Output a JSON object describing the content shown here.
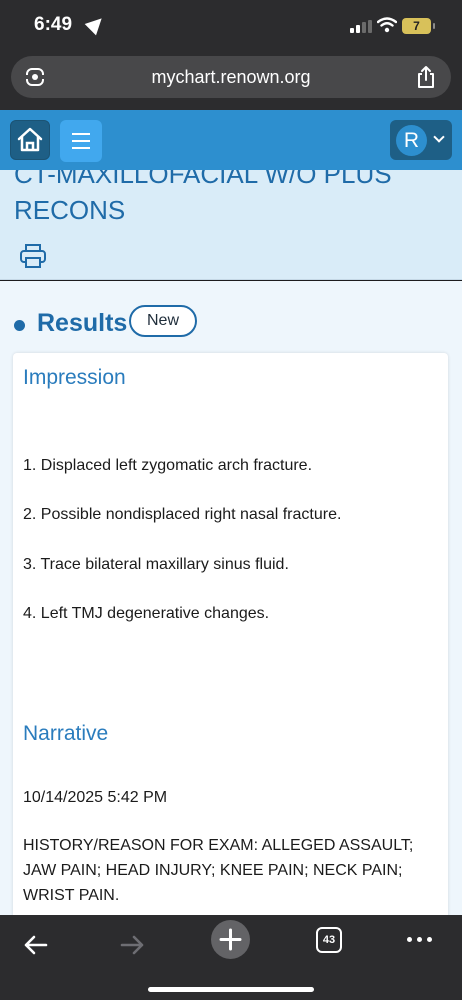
{
  "status_bar": {
    "time": "6:49",
    "battery": "7"
  },
  "browser": {
    "url": "mychart.renown.org",
    "open_tabs": "43"
  },
  "header": {
    "avatar_initial": "R"
  },
  "page": {
    "title": "CT-MAXILLOFACIAL W/O PLUS RECONS"
  },
  "results": {
    "label": "Results",
    "badge": "New"
  },
  "impression": {
    "heading": "Impression",
    "items": [
      "1. Displaced left zygomatic arch fracture.",
      "2. Possible nondisplaced right nasal fracture.",
      "3. Trace bilateral maxillary sinus fluid.",
      "4. Left TMJ degenerative changes."
    ]
  },
  "narrative": {
    "heading": "Narrative",
    "timestamp": "10/14/2025 5:42 PM",
    "history": "HISTORY/REASON FOR EXAM: ALLEGED ASSAULT; JAW PAIN; HEAD INJURY; KNEE PAIN; NECK PAIN; WRIST PAIN."
  },
  "colors": {
    "brand_blue": "#2d8fcf",
    "heading_blue": "#1f6ba8",
    "title_band": "#d9ecf8"
  },
  "icons": [
    "location-arrow-icon",
    "signal-icon",
    "wifi-icon",
    "battery-icon",
    "reader-icon",
    "share-icon",
    "home-icon",
    "menu-icon",
    "chevron-down-icon",
    "print-icon",
    "back-icon",
    "forward-icon",
    "plus-icon",
    "tabs-icon",
    "more-icon"
  ]
}
